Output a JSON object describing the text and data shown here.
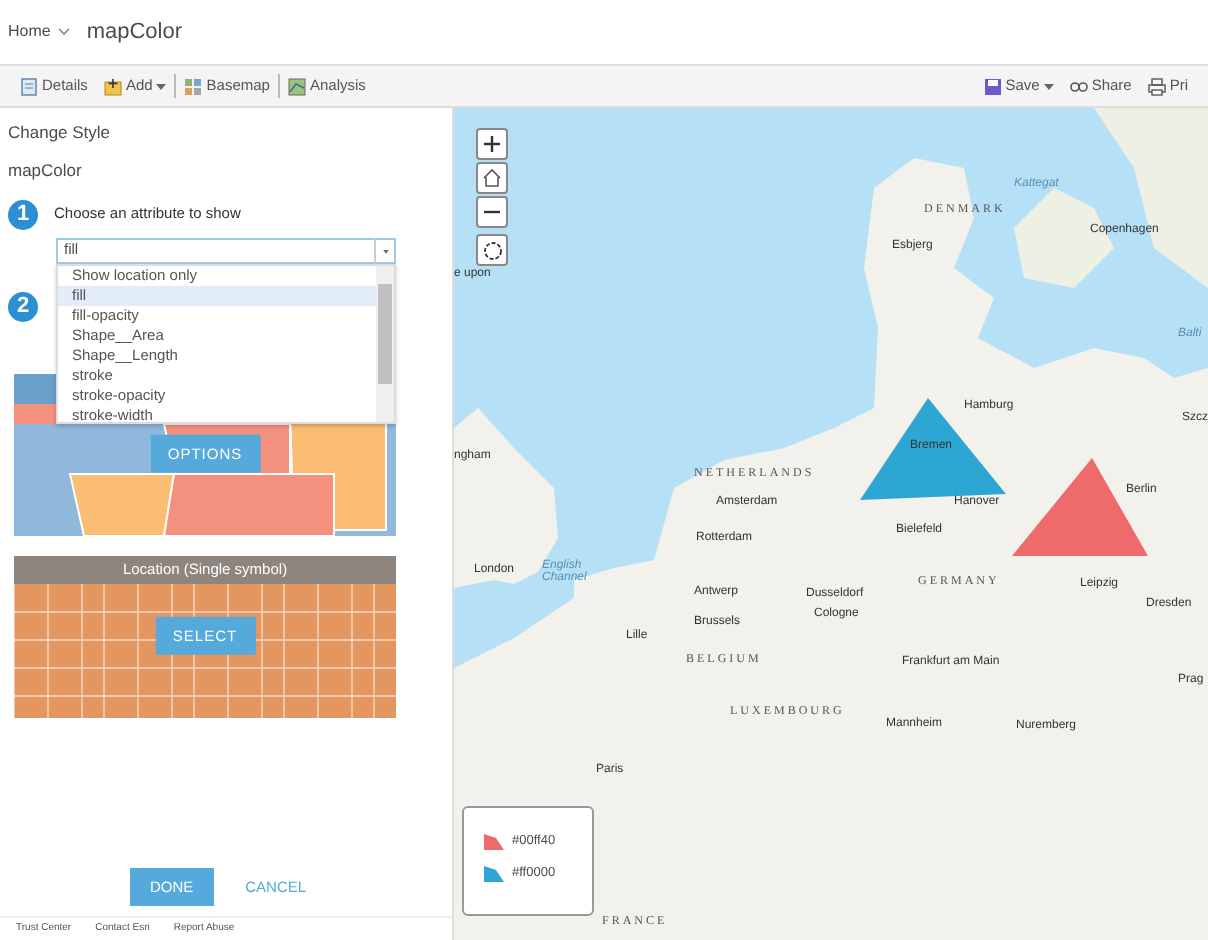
{
  "header": {
    "home": "Home",
    "title": "mapColor"
  },
  "toolbar": {
    "left": [
      {
        "label": "Details",
        "kind": "details",
        "caret": false
      },
      {
        "label": "Add",
        "kind": "add",
        "caret": true
      },
      {
        "label": "Basemap",
        "kind": "basemap",
        "caret": false
      },
      {
        "label": "Analysis",
        "kind": "analysis",
        "caret": false
      }
    ],
    "right": [
      {
        "label": "Save",
        "kind": "save",
        "caret": true
      },
      {
        "label": "Share",
        "kind": "share",
        "caret": false
      },
      {
        "label": "Pri",
        "kind": "print",
        "caret": false
      }
    ]
  },
  "panel": {
    "title": "Change Style",
    "layer": "mapColor",
    "step1": {
      "number": "1",
      "label": "Choose an attribute to show",
      "value": "fill",
      "options": [
        {
          "label": "Show location only",
          "selected": false
        },
        {
          "label": "fill",
          "selected": true
        },
        {
          "label": "fill-opacity",
          "selected": false
        },
        {
          "label": "Shape__Area",
          "selected": false
        },
        {
          "label": "Shape__Length",
          "selected": false
        },
        {
          "label": "stroke",
          "selected": false
        },
        {
          "label": "stroke-opacity",
          "selected": false
        },
        {
          "label": "stroke-width",
          "selected": false
        }
      ]
    },
    "step2": {
      "number": "2"
    },
    "styles": [
      {
        "kind": "types",
        "button": "OPTIONS"
      },
      {
        "kind": "location",
        "title": "Location (Single symbol)",
        "button": "SELECT"
      }
    ],
    "done": "DONE",
    "cancel": "CANCEL",
    "footer": [
      "Trust Center",
      "Contact Esri",
      "Report Abuse"
    ]
  },
  "map": {
    "labels": [
      {
        "text": "DENMARK",
        "kind": "country"
      },
      {
        "text": "Kattegat",
        "kind": "water"
      },
      {
        "text": "Esbjerg",
        "kind": "city"
      },
      {
        "text": "Copenhagen",
        "kind": "city"
      },
      {
        "text": "e upon",
        "kind": "city"
      },
      {
        "text": "Balti",
        "kind": "water"
      },
      {
        "text": "Hamburg",
        "kind": "city"
      },
      {
        "text": "Szcz",
        "kind": "city"
      },
      {
        "text": "Bremen",
        "kind": "city"
      },
      {
        "text": "ngham",
        "kind": "city"
      },
      {
        "text": "NETHERLANDS",
        "kind": "country"
      },
      {
        "text": "Berlin",
        "kind": "city"
      },
      {
        "text": "Amsterdam",
        "kind": "city"
      },
      {
        "text": "Hanover",
        "kind": "city"
      },
      {
        "text": "Bielefeld",
        "kind": "city"
      },
      {
        "text": "Rotterdam",
        "kind": "city"
      },
      {
        "text": "London",
        "kind": "city"
      },
      {
        "text": "English Channel",
        "kind": "water"
      },
      {
        "text": "GERMANY",
        "kind": "country"
      },
      {
        "text": "Leipzig",
        "kind": "city"
      },
      {
        "text": "Antwerp",
        "kind": "city"
      },
      {
        "text": "Dusseldorf",
        "kind": "city"
      },
      {
        "text": "Dresden",
        "kind": "city"
      },
      {
        "text": "Cologne",
        "kind": "city"
      },
      {
        "text": "Brussels",
        "kind": "city"
      },
      {
        "text": "Lille",
        "kind": "city"
      },
      {
        "text": "BELGIUM",
        "kind": "country"
      },
      {
        "text": "Frankfurt am Main",
        "kind": "city"
      },
      {
        "text": "Prag",
        "kind": "city"
      },
      {
        "text": "LUXEMBOURG",
        "kind": "country"
      },
      {
        "text": "Mannheim",
        "kind": "city"
      },
      {
        "text": "Nuremberg",
        "kind": "city"
      },
      {
        "text": "Paris",
        "kind": "city"
      },
      {
        "text": "FRANCE",
        "kind": "country"
      }
    ],
    "features": [
      {
        "color": "#2ea6d3"
      },
      {
        "color": "#ef6b6b"
      }
    ],
    "legend": [
      {
        "label": "#00ff40",
        "color": "#ef6b6b"
      },
      {
        "label": "#ff0000",
        "color": "#2ea6d3"
      }
    ]
  }
}
